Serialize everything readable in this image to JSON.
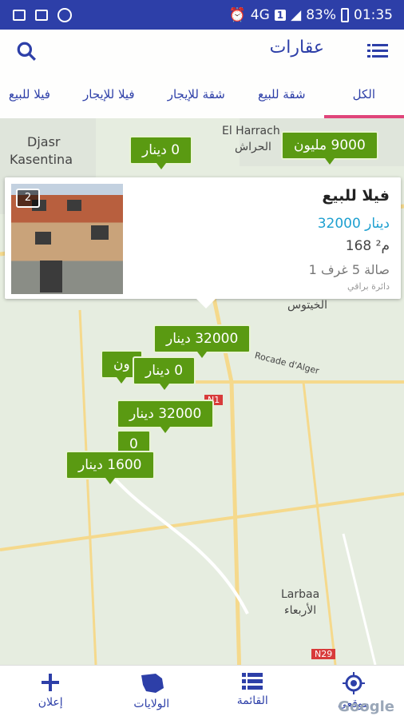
{
  "status_bar": {
    "network": "4G",
    "sim": "1",
    "battery": "83%",
    "time": "01:35"
  },
  "app_bar": {
    "title": "عقارات"
  },
  "tabs": [
    {
      "label": "الكل",
      "active": true
    },
    {
      "label": "شقة للبيع",
      "active": false
    },
    {
      "label": "شقة للإيجار",
      "active": false
    },
    {
      "label": "فيلا للإيجار",
      "active": false
    },
    {
      "label": "فيلا للبيع",
      "active": false
    }
  ],
  "map": {
    "labels": {
      "djasr": "Djasr",
      "kasentina": "Kasentina",
      "el_harrach": "El Harrach",
      "el_harrach_ar": "الحراش",
      "rocade": "Rocade d'Alger",
      "larbaa": "Larbaa",
      "larbaa_ar": "الأربعاء",
      "n29": "N29",
      "n1": "N1",
      "alkhatous": "الخيتوس"
    },
    "pins": [
      {
        "label": "0 دينار"
      },
      {
        "label": "9000 مليون"
      },
      {
        "label": "32000 دينار"
      },
      {
        "label": "0 دينار"
      },
      {
        "label": "32000 دينار"
      },
      {
        "label": "1600 دينار"
      },
      {
        "label": "ون"
      },
      {
        "label": "0"
      }
    ]
  },
  "info_card": {
    "title": "فيلا للبيع",
    "price": "32000 دينار",
    "area": "168 م²",
    "rooms": "1 صالة 5 غرف",
    "district": "دائرة براقي",
    "photo_count": "2"
  },
  "bottom_nav": [
    {
      "label": "موقعي",
      "icon": "location-target-icon"
    },
    {
      "label": "القائمة",
      "icon": "list-icon"
    },
    {
      "label": "الولايات",
      "icon": "algeria-map-icon"
    },
    {
      "label": "إعلان",
      "icon": "plus-icon"
    }
  ],
  "google_logo": "Google",
  "colors": {
    "primary": "#2d3fa8",
    "pin": "#5a9a12",
    "price": "#1ea0d0",
    "active_tab": "#e0457a"
  }
}
